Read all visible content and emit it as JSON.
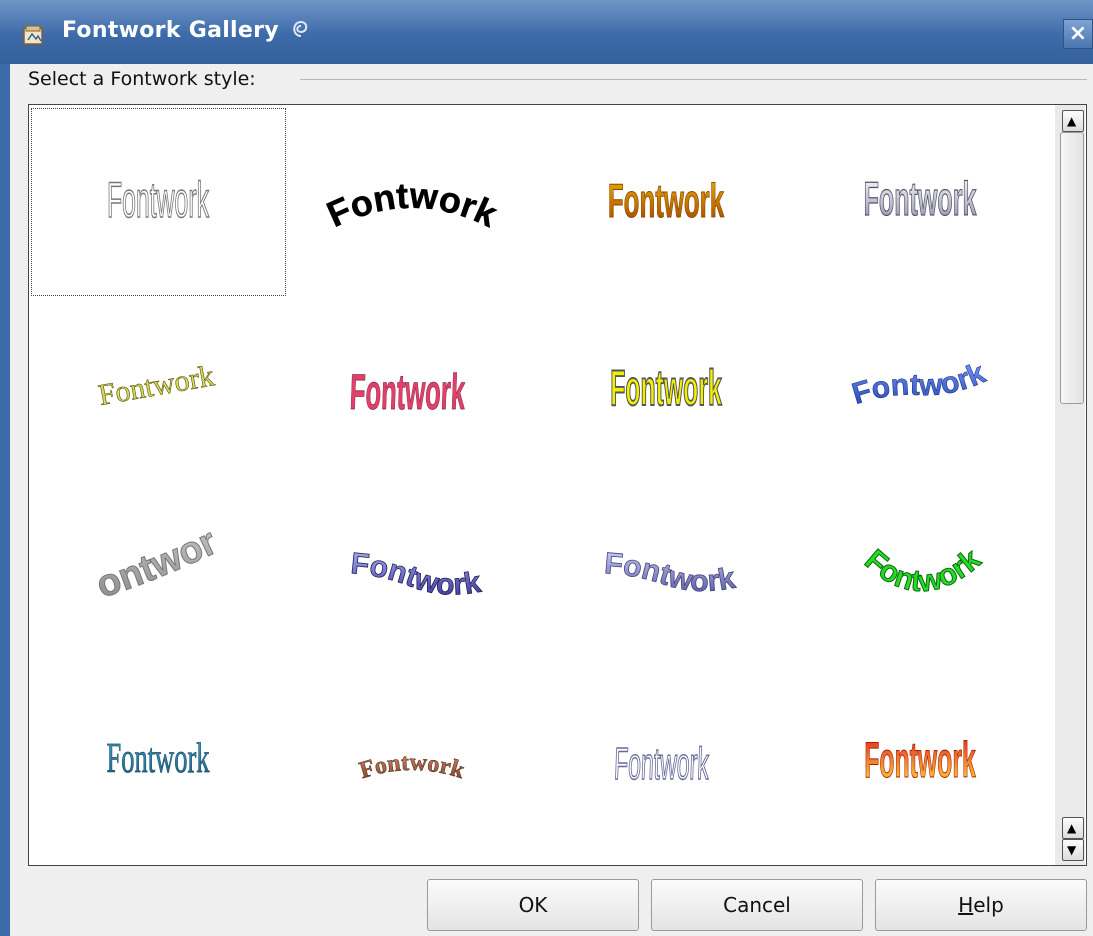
{
  "window": {
    "title": "Fontwork Gallery",
    "close_glyph": "×"
  },
  "prompt_label": "Select a Fontwork style:",
  "gallery": {
    "selected_index": 0,
    "items": [
      {
        "text": "Fontwork",
        "style": "outline-plain",
        "fill": "#ffffff",
        "stroke": "#777777"
      },
      {
        "text": "Fontwork",
        "style": "arch-black",
        "fill": "#000000",
        "stroke": "#000000"
      },
      {
        "text": "Fontwork",
        "style": "gold-gradient",
        "fill": "#c07a10",
        "stroke": "#8a4a00"
      },
      {
        "text": "Fontwork",
        "style": "silver-3d",
        "fill": "#c8c8d8",
        "stroke": "#555566"
      },
      {
        "text": "Fontwork",
        "style": "slanted-serif",
        "fill": "#d8d860",
        "stroke": "#555500"
      },
      {
        "text": "Fontwork",
        "style": "pink-perspective",
        "fill": "#e0406a",
        "stroke": "#802040"
      },
      {
        "text": "Fontwork",
        "style": "yellow-3d",
        "fill": "#f0f000",
        "stroke": "#555555"
      },
      {
        "text": "Fontwork",
        "style": "blue-wave",
        "fill": "#4a6ed8",
        "stroke": "#223388"
      },
      {
        "text": "Fontwork",
        "style": "grey-extrude",
        "fill": "#d0d0d0",
        "stroke": "#777777"
      },
      {
        "text": "Fontwork",
        "style": "violet-wave",
        "fill": "#7070c8",
        "stroke": "#222255"
      },
      {
        "text": "Fontwork",
        "style": "lavender-shadow",
        "fill": "#9090d8",
        "stroke": "#444477"
      },
      {
        "text": "Fontwork",
        "style": "green-arc",
        "fill": "#22dd22",
        "stroke": "#116611"
      },
      {
        "text": "Fontwork",
        "style": "teal-serif",
        "fill": "#2c8cb0",
        "stroke": "#1a4a66"
      },
      {
        "text": "Fontwork",
        "style": "brown-arch",
        "fill": "#c07050",
        "stroke": "#553322"
      },
      {
        "text": "Fontwork",
        "style": "lavender-outline",
        "fill": "#ffffff",
        "stroke": "#6a6a9a"
      },
      {
        "text": "Fontwork",
        "style": "fire-gradient",
        "fill": "#f05020",
        "stroke": "#aa2000"
      }
    ]
  },
  "scrollbar": {
    "up_glyph": "▲",
    "down_glyph": "▼"
  },
  "buttons": {
    "ok": "OK",
    "cancel": "Cancel",
    "help_mnemonic": "H",
    "help_rest": "elp"
  },
  "icons": {
    "app": "gallery-app-icon",
    "swirl": "swirl-icon",
    "close": "close-icon"
  }
}
